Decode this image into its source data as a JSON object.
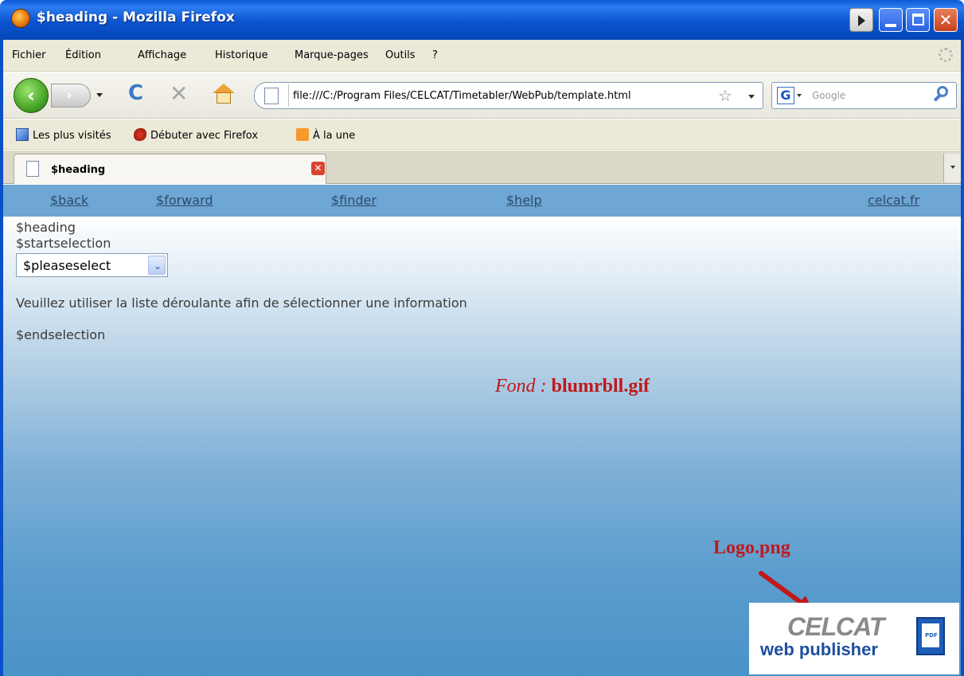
{
  "window": {
    "title": "$heading - Mozilla Firefox"
  },
  "menu": {
    "items": [
      "Fichier",
      "Édition",
      "Affichage",
      "Historique",
      "Marque-pages",
      "Outils",
      "?"
    ]
  },
  "navbar": {
    "url": "file:///C:/Program Files/CELCAT/Timetabler/WebPub/template.html",
    "search_placeholder": "Google",
    "search_engine_letter": "G"
  },
  "bookmarks": {
    "items": [
      "Les plus visités",
      "Débuter avec Firefox",
      "À la une"
    ]
  },
  "tabs": [
    {
      "label": "$heading",
      "active": true
    }
  ],
  "page": {
    "nav_links": [
      "$back",
      "$forward",
      "$finder",
      "$help",
      "celcat.fr"
    ],
    "heading": "$heading",
    "startselection": "$startselection",
    "select_value": "$pleaseselect",
    "instruction": "Veuillez utiliser la liste déroulante afin de sélectionner une information",
    "endselection": "$endselection"
  },
  "annotations": {
    "fond_label": "Fond :",
    "fond_file": "blumrbll.gif",
    "logo_label": "Logo.png",
    "color": "#c0181b"
  },
  "logo": {
    "line1": "CELCAT",
    "line2": "web publisher",
    "badge": "PDF"
  },
  "colors": {
    "titlebar": "#0b54cf",
    "nav_strip": "#6ea6d4",
    "link": "#2c4b6a"
  }
}
